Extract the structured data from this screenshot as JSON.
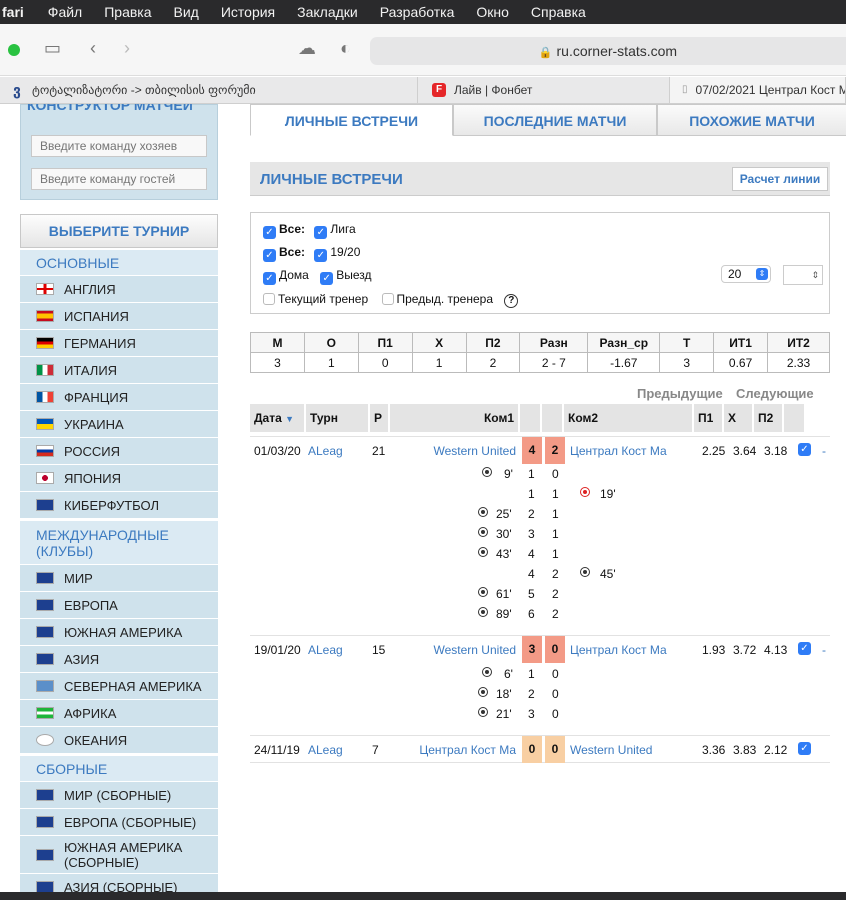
{
  "menubar": {
    "app": "fari",
    "items": [
      "Файл",
      "Правка",
      "Вид",
      "История",
      "Закладки",
      "Разработка",
      "Окно",
      "Справка"
    ]
  },
  "browser": {
    "url": "ru.corner-stats.com",
    "tabs": [
      {
        "label": "ტოტალიზატორი -> თბილისის ფორუმი"
      },
      {
        "label": "Лайв | Фонбет"
      },
      {
        "label": "07/02/2021 Централ Кост М"
      }
    ]
  },
  "sidebar": {
    "constructor_title": "КОНСТРУКТОР МАТЧЕЙ",
    "home_placeholder": "Введите команду хозяев",
    "away_placeholder": "Введите команду гостей",
    "tournament_button": "ВЫБЕРИТЕ ТУРНИР",
    "sections": [
      {
        "title": "ОСНОВНЫЕ",
        "items": [
          "АНГЛИЯ",
          "ИСПАНИЯ",
          "ГЕРМАНИЯ",
          "ИТАЛИЯ",
          "ФРАНЦИЯ",
          "УКРАИНА",
          "РОССИЯ",
          "ЯПОНИЯ",
          "КИБЕРФУТБОЛ"
        ]
      },
      {
        "title": "МЕЖДУНАРОДНЫЕ (КЛУБЫ)",
        "items": [
          "МИР",
          "ЕВРОПА",
          "ЮЖНАЯ АМЕРИКА",
          "АЗИЯ",
          "СЕВЕРНАЯ АМЕРИКА",
          "АФРИКА",
          "ОКЕАНИЯ"
        ]
      },
      {
        "title": "СБОРНЫЕ",
        "items": [
          "МИР (СБОРНЫЕ)",
          "ЕВРОПА (СБОРНЫЕ)",
          "ЮЖНАЯ АМЕРИКА (СБОРНЫЕ)",
          "АЗИЯ (СБОРНЫЕ)"
        ]
      }
    ]
  },
  "main": {
    "tabs": [
      "ЛИЧНЫЕ ВСТРЕЧИ",
      "ПОСЛЕДНИЕ МАТЧИ",
      "ПОХОЖИЕ МАТЧИ"
    ],
    "section_title": "ЛИЧНЫЕ ВСТРЕЧИ",
    "calc_button": "Расчет линии",
    "filters": {
      "all1": "Все:",
      "league": "Лига",
      "all2": "Все:",
      "season": "19/20",
      "home": "Дома",
      "away": "Выезд",
      "count": "20",
      "current_coach": "Текущий тренер",
      "prev_coach": "Предыд. тренера",
      "help": "?"
    },
    "stats": {
      "headers": [
        "М",
        "О",
        "П1",
        "Х",
        "П2",
        "Разн",
        "Разн_ср",
        "Т",
        "ИТ1",
        "ИТ2"
      ],
      "values": [
        "3",
        "1",
        "0",
        "1",
        "2",
        "2 - 7",
        "-1.67",
        "3",
        "0.67",
        "2.33"
      ]
    },
    "prev": "Предыдущие",
    "next": "Следующие",
    "table_headers": [
      "Дата",
      "Турн",
      "Р",
      "Ком1",
      "Ком2",
      "П1",
      "Х",
      "П2"
    ],
    "matches": [
      {
        "date": "01/03/20",
        "tourn": "ALeag",
        "round": "21",
        "team1": "Western United",
        "s1": "4",
        "s2": "2",
        "team2": "Централ Кост Ма",
        "p1": "2.25",
        "x": "3.64",
        "p2": "3.18",
        "dash": "-",
        "goals": [
          {
            "t1": "9'",
            "a": "1",
            "b": "0"
          },
          {
            "t2": "19'",
            "a": "1",
            "b": "1"
          },
          {
            "t1": "25'",
            "a": "2",
            "b": "1"
          },
          {
            "t1": "30'",
            "a": "3",
            "b": "1"
          },
          {
            "t1": "43'",
            "a": "4",
            "b": "1"
          },
          {
            "t2": "45'",
            "a": "4",
            "b": "2"
          },
          {
            "t1": "61'",
            "a": "5",
            "b": "2"
          },
          {
            "t1": "89'",
            "a": "6",
            "b": "2"
          }
        ]
      },
      {
        "date": "19/01/20",
        "tourn": "ALeag",
        "round": "15",
        "team1": "Western United",
        "s1": "3",
        "s2": "0",
        "team2": "Централ Кост Ма",
        "p1": "1.93",
        "x": "3.72",
        "p2": "4.13",
        "dash": "-",
        "goals": [
          {
            "t1": "6'",
            "a": "1",
            "b": "0"
          },
          {
            "t1": "18'",
            "a": "2",
            "b": "0"
          },
          {
            "t1": "21'",
            "a": "3",
            "b": "0"
          }
        ]
      },
      {
        "date": "24/11/19",
        "tourn": "ALeag",
        "round": "7",
        "team1": "Централ Кост Ма",
        "s1": "0",
        "s2": "0",
        "team2": "Western United",
        "p1": "3.36",
        "x": "3.83",
        "p2": "2.12",
        "dash": "",
        "goals": []
      }
    ]
  },
  "colors": {
    "accent": "#3c7ac0",
    "score_win": "#f39a86",
    "score_draw": "#f8cfa3"
  }
}
